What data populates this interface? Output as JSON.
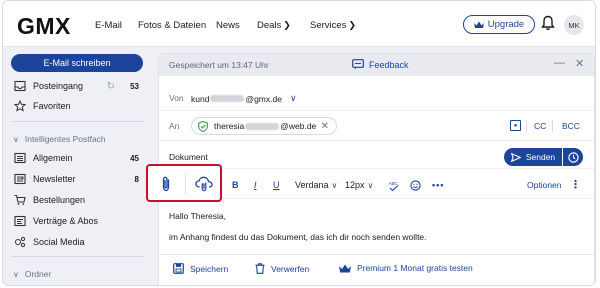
{
  "header": {
    "logo": "GMX",
    "nav": [
      {
        "label": "E-Mail"
      },
      {
        "label": "Fotos & Dateien"
      },
      {
        "label": "News"
      },
      {
        "label": "Deals",
        "dropdown": true
      },
      {
        "label": "Services",
        "dropdown": true
      }
    ],
    "upgrade_label": "Upgrade",
    "avatar_initials": "MK"
  },
  "sidebar": {
    "compose_label": "E-Mail schreiben",
    "inbox": {
      "label": "Posteingang",
      "count": "53"
    },
    "favorites": {
      "label": "Favoriten"
    },
    "smart_section": "Intelligentes Postfach",
    "smart_items": [
      {
        "label": "Allgemein",
        "count": "45"
      },
      {
        "label": "Newsletter",
        "count": "8"
      },
      {
        "label": "Bestellungen",
        "count": ""
      },
      {
        "label": "Verträge & Abos",
        "count": ""
      },
      {
        "label": "Social Media",
        "count": ""
      }
    ],
    "folders_section": "Ordner"
  },
  "compose": {
    "saved_text": "Gespeichert um 13:47 Uhr",
    "feedback_label": "Feedback",
    "from_label": "Von",
    "from_prefix": "kund",
    "from_domain": "@gmx.de",
    "to_label": "An",
    "recipient_prefix": "theresia",
    "recipient_domain": "@web.de",
    "cc_label": "CC",
    "bcc_label": "BCC",
    "subject": "Dokument",
    "send_label": "Senden",
    "toolbar": {
      "bold": "B",
      "italic": "I",
      "underline": "U",
      "font": "Verdana",
      "size": "12px",
      "options": "Optionen"
    },
    "body_lines": [
      "Hallo Theresia,",
      "im Anhang findest du das Dokument, das ich dir noch senden wollte."
    ],
    "footer": {
      "save": "Speichern",
      "discard": "Verwerfen",
      "premium": "Premium 1 Monat gratis testen"
    }
  },
  "colors": {
    "brand_blue": "#1c449b",
    "highlight_red": "#c8102e"
  }
}
